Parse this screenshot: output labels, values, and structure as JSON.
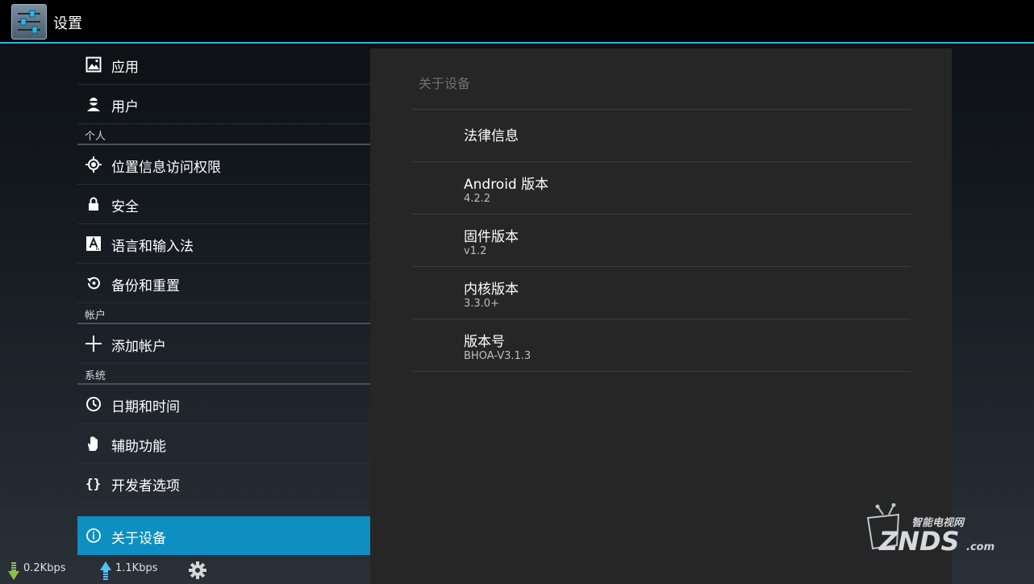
{
  "app": {
    "title": "设置",
    "icon": "settings-sliders-icon"
  },
  "sidebar": {
    "items": [
      {
        "type": "item",
        "label": "应用",
        "icon": "apps-image-icon"
      },
      {
        "type": "item",
        "label": "用户",
        "icon": "user-icon"
      },
      {
        "type": "header",
        "label": "个人"
      },
      {
        "type": "item",
        "label": "位置信息访问权限",
        "icon": "location-icon"
      },
      {
        "type": "item",
        "label": "安全",
        "icon": "lock-icon"
      },
      {
        "type": "item",
        "label": "语言和输入法",
        "icon": "language-icon"
      },
      {
        "type": "item",
        "label": "备份和重置",
        "icon": "backup-restore-icon"
      },
      {
        "type": "header",
        "label": "帐户"
      },
      {
        "type": "item",
        "label": "添加帐户",
        "icon": "plus-icon"
      },
      {
        "type": "header",
        "label": "系统"
      },
      {
        "type": "item",
        "label": "日期和时间",
        "icon": "clock-icon"
      },
      {
        "type": "item",
        "label": "辅助功能",
        "icon": "hand-icon"
      },
      {
        "type": "item",
        "label": "开发者选项",
        "icon": "braces-icon"
      },
      {
        "type": "item",
        "label": "关于设备",
        "icon": "info-icon",
        "selected": true
      }
    ]
  },
  "panel": {
    "title": "关于设备",
    "rows": [
      {
        "title": "法律信息",
        "subtitle": ""
      },
      {
        "title": "Android 版本",
        "subtitle": "4.2.2"
      },
      {
        "title": "固件版本",
        "subtitle": "v1.2"
      },
      {
        "title": "内核版本",
        "subtitle": "3.3.0+"
      },
      {
        "title": "版本号",
        "subtitle": "BHOA-V3.1.3"
      }
    ]
  },
  "statusbar": {
    "download_speed": "0.2Kbps",
    "upload_speed": "1.1Kbps",
    "settings_icon": "gear-icon"
  },
  "watermark": {
    "brand": "ZNDS",
    "tagline": "智能电视网",
    "suffix": ".com"
  },
  "colors": {
    "accent": "#33b5e5",
    "selected": "#0e8fc1",
    "panel_bg": "#262626",
    "download_arrow": "#8bc34a",
    "upload_arrow": "#4fc3f7"
  }
}
